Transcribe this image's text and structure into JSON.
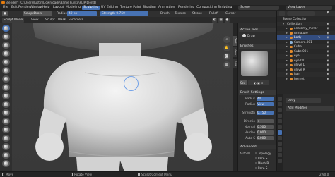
{
  "window": {
    "title": "Blender* [C:\\Users\\Justin\\Downloads\\Bame Funko\\FLIP blend]"
  },
  "menubar": {
    "items": [
      "File",
      "Edit",
      "Render",
      "Window",
      "Help",
      "Layout",
      "Modeling",
      "Sculpting",
      "UV Editing",
      "Texture Paint",
      "Shading",
      "Animation",
      "Rendering",
      "Compositing",
      "Scripting"
    ],
    "active": "Sculpting",
    "scene": "Scene",
    "view_layer": "View Layer"
  },
  "tool_header": {
    "brush_name": "SculptDraw",
    "radius_label": "Radius",
    "radius_value": "40 px",
    "strength_label": "Strength",
    "strength_value": "0.750",
    "brush_menu": "Brush",
    "texture_menu": "Texture",
    "stroke_menu": "Stroke",
    "falloff_menu": "Falloff",
    "cursor_menu": "Cursor"
  },
  "mode_header": {
    "mode": "Sculpt Mode",
    "view": "View",
    "sculpt": "Sculpt",
    "mask": "Mask",
    "face_sets": "Face Sets"
  },
  "npanel": {
    "tabs": [
      "Tool",
      "View",
      "Edit"
    ],
    "active_tool_header": "Active Tool",
    "active_tool_name": "Draw",
    "brushes_header": "Brushes",
    "brush_field": "Scu",
    "brush_settings_header": "Brush Settings",
    "rows": [
      {
        "label": "Radius",
        "value": "40"
      },
      {
        "label": "Radius",
        "value": "View"
      },
      {
        "label": "Strength",
        "value": "0.750"
      },
      {
        "label": "Directio",
        "value": "+"
      },
      {
        "label": "Normal",
        "value": "0.500"
      },
      {
        "label": "Hardne",
        "value": "0.000"
      },
      {
        "label": "Auto-S",
        "value": "0.000"
      }
    ],
    "advanced_header": "Advanced",
    "auto_masking_label": "Auto-M...",
    "auto_masking_options": [
      "Topology",
      "Face S...",
      "Mesh B...",
      "Face S..."
    ]
  },
  "outliner": {
    "rows": [
      {
        "name": "Scene Collection",
        "sel": false
      },
      {
        "name": "Collection",
        "sel": false
      },
      {
        "name": "anatomy_mirror",
        "sel": false
      },
      {
        "name": "Armature",
        "sel": false
      },
      {
        "name": "body",
        "sel": true
      },
      {
        "name": "Camera.001",
        "sel": false
      },
      {
        "name": "Cube",
        "sel": false
      },
      {
        "name": "Cube.001",
        "sel": false
      },
      {
        "name": "eye",
        "sel": false
      },
      {
        "name": "eye.001",
        "sel": false
      },
      {
        "name": "glove L",
        "sel": false
      },
      {
        "name": "glove R",
        "sel": false
      },
      {
        "name": "hair",
        "sel": false
      },
      {
        "name": "helmet",
        "sel": false
      }
    ]
  },
  "properties": {
    "object_name": "body",
    "add_modifier": "Add Modifier"
  },
  "statusbar": {
    "select": "Move",
    "middle": "Rotate View",
    "right": "Sculpt Context Menu",
    "version": "2.90.0"
  },
  "colors": {
    "accent": "#4772b3",
    "selection": "#334d80",
    "object_icon": "#e38b2c"
  }
}
